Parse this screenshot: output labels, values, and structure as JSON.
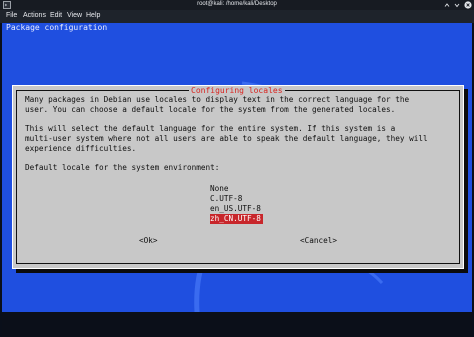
{
  "window": {
    "title": "root@kali: /home/kali/Desktop"
  },
  "menu": {
    "file": "File",
    "actions": "Actions",
    "edit": "Edit",
    "view": "View",
    "help": "Help"
  },
  "terminal": {
    "header": "Package configuration"
  },
  "dialog": {
    "title": "Configuring locales",
    "paragraph1_line1": "Many packages in Debian use locales to display text in the correct language for the",
    "paragraph1_line2": "user. You can choose a default locale for the system from the generated locales.",
    "paragraph2_line1": "This will select the default language for the entire system. If this system is a",
    "paragraph2_line2": "multi-user system where not all users are able to speak the default language, they will",
    "paragraph2_line3": "experience difficulties.",
    "prompt": "Default locale for the system environment:",
    "options": [
      "None",
      "C.UTF-8",
      "en_US.UTF-8",
      "zh_CN.UTF-8"
    ],
    "selected_option": "zh_CN.UTF-8",
    "ok_button": "<Ok>",
    "cancel_button": "<Cancel>"
  },
  "colors": {
    "background_blue": "#1f4fe0",
    "dialog_gray": "#c8c8c8",
    "title_red": "#d9241f",
    "selection_red": "#c8262b"
  },
  "icons": [
    "terminal-icon",
    "minimize-icon",
    "maximize-icon",
    "close-icon",
    "kali-dragon-logo"
  ]
}
